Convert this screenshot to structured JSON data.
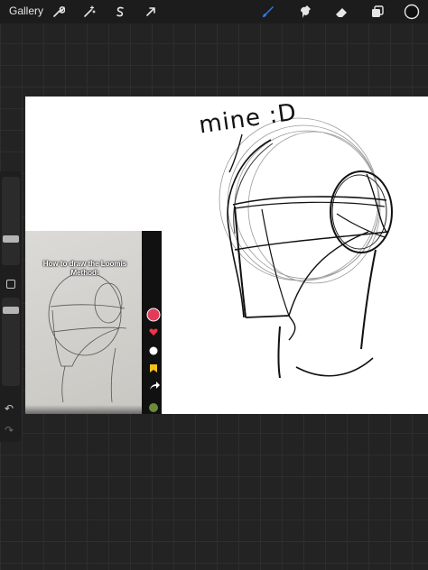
{
  "toolbar": {
    "gallery_label": "Gallery",
    "left_icons": [
      "wrench-icon",
      "magic-wand-icon",
      "selection-icon",
      "transform-arrow-icon"
    ],
    "right_icons": [
      "brush-icon",
      "smudge-icon",
      "eraser-icon",
      "layers-icon",
      "color-swatch-icon"
    ],
    "active_tool": "brush",
    "accent_color": "#2b7bf2"
  },
  "canvas": {
    "annotation_text": "mine :D",
    "background": "#ffffff"
  },
  "reference": {
    "title": "How to draw the Loomis Method:",
    "side_icons": [
      "avatar-icon",
      "like-icon",
      "comment-icon",
      "bookmark-icon",
      "share-icon",
      "music-disc-icon"
    ]
  },
  "sidebar": {
    "controls": [
      "brush-size-slider",
      "modify-button",
      "opacity-slider",
      "undo-icon",
      "redo-icon"
    ],
    "undo_glyph": "↶",
    "redo_glyph": "↷"
  }
}
